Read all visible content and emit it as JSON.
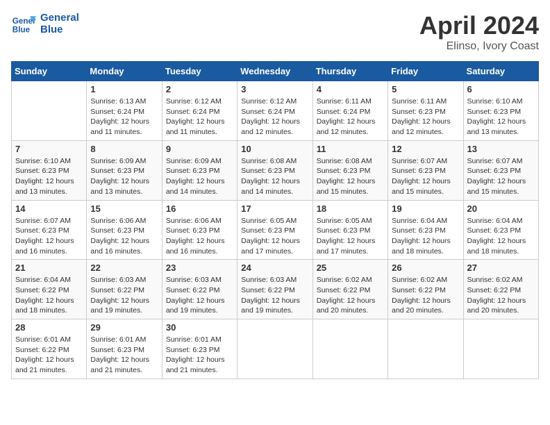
{
  "header": {
    "logo_line1": "General",
    "logo_line2": "Blue",
    "title": "April 2024",
    "subtitle": "Elinso, Ivory Coast"
  },
  "calendar": {
    "days_of_week": [
      "Sunday",
      "Monday",
      "Tuesday",
      "Wednesday",
      "Thursday",
      "Friday",
      "Saturday"
    ],
    "weeks": [
      [
        {
          "day": "",
          "info": ""
        },
        {
          "day": "1",
          "info": "Sunrise: 6:13 AM\nSunset: 6:24 PM\nDaylight: 12 hours and 11 minutes."
        },
        {
          "day": "2",
          "info": "Sunrise: 6:12 AM\nSunset: 6:24 PM\nDaylight: 12 hours and 11 minutes."
        },
        {
          "day": "3",
          "info": "Sunrise: 6:12 AM\nSunset: 6:24 PM\nDaylight: 12 hours and 12 minutes."
        },
        {
          "day": "4",
          "info": "Sunrise: 6:11 AM\nSunset: 6:24 PM\nDaylight: 12 hours and 12 minutes."
        },
        {
          "day": "5",
          "info": "Sunrise: 6:11 AM\nSunset: 6:23 PM\nDaylight: 12 hours and 12 minutes."
        },
        {
          "day": "6",
          "info": "Sunrise: 6:10 AM\nSunset: 6:23 PM\nDaylight: 12 hours and 13 minutes."
        }
      ],
      [
        {
          "day": "7",
          "info": "Sunrise: 6:10 AM\nSunset: 6:23 PM\nDaylight: 12 hours and 13 minutes."
        },
        {
          "day": "8",
          "info": "Sunrise: 6:09 AM\nSunset: 6:23 PM\nDaylight: 12 hours and 13 minutes."
        },
        {
          "day": "9",
          "info": "Sunrise: 6:09 AM\nSunset: 6:23 PM\nDaylight: 12 hours and 14 minutes."
        },
        {
          "day": "10",
          "info": "Sunrise: 6:08 AM\nSunset: 6:23 PM\nDaylight: 12 hours and 14 minutes."
        },
        {
          "day": "11",
          "info": "Sunrise: 6:08 AM\nSunset: 6:23 PM\nDaylight: 12 hours and 15 minutes."
        },
        {
          "day": "12",
          "info": "Sunrise: 6:07 AM\nSunset: 6:23 PM\nDaylight: 12 hours and 15 minutes."
        },
        {
          "day": "13",
          "info": "Sunrise: 6:07 AM\nSunset: 6:23 PM\nDaylight: 12 hours and 15 minutes."
        }
      ],
      [
        {
          "day": "14",
          "info": "Sunrise: 6:07 AM\nSunset: 6:23 PM\nDaylight: 12 hours and 16 minutes."
        },
        {
          "day": "15",
          "info": "Sunrise: 6:06 AM\nSunset: 6:23 PM\nDaylight: 12 hours and 16 minutes."
        },
        {
          "day": "16",
          "info": "Sunrise: 6:06 AM\nSunset: 6:23 PM\nDaylight: 12 hours and 16 minutes."
        },
        {
          "day": "17",
          "info": "Sunrise: 6:05 AM\nSunset: 6:23 PM\nDaylight: 12 hours and 17 minutes."
        },
        {
          "day": "18",
          "info": "Sunrise: 6:05 AM\nSunset: 6:23 PM\nDaylight: 12 hours and 17 minutes."
        },
        {
          "day": "19",
          "info": "Sunrise: 6:04 AM\nSunset: 6:23 PM\nDaylight: 12 hours and 18 minutes."
        },
        {
          "day": "20",
          "info": "Sunrise: 6:04 AM\nSunset: 6:23 PM\nDaylight: 12 hours and 18 minutes."
        }
      ],
      [
        {
          "day": "21",
          "info": "Sunrise: 6:04 AM\nSunset: 6:22 PM\nDaylight: 12 hours and 18 minutes."
        },
        {
          "day": "22",
          "info": "Sunrise: 6:03 AM\nSunset: 6:22 PM\nDaylight: 12 hours and 19 minutes."
        },
        {
          "day": "23",
          "info": "Sunrise: 6:03 AM\nSunset: 6:22 PM\nDaylight: 12 hours and 19 minutes."
        },
        {
          "day": "24",
          "info": "Sunrise: 6:03 AM\nSunset: 6:22 PM\nDaylight: 12 hours and 19 minutes."
        },
        {
          "day": "25",
          "info": "Sunrise: 6:02 AM\nSunset: 6:22 PM\nDaylight: 12 hours and 20 minutes."
        },
        {
          "day": "26",
          "info": "Sunrise: 6:02 AM\nSunset: 6:22 PM\nDaylight: 12 hours and 20 minutes."
        },
        {
          "day": "27",
          "info": "Sunrise: 6:02 AM\nSunset: 6:22 PM\nDaylight: 12 hours and 20 minutes."
        }
      ],
      [
        {
          "day": "28",
          "info": "Sunrise: 6:01 AM\nSunset: 6:22 PM\nDaylight: 12 hours and 21 minutes."
        },
        {
          "day": "29",
          "info": "Sunrise: 6:01 AM\nSunset: 6:23 PM\nDaylight: 12 hours and 21 minutes."
        },
        {
          "day": "30",
          "info": "Sunrise: 6:01 AM\nSunset: 6:23 PM\nDaylight: 12 hours and 21 minutes."
        },
        {
          "day": "",
          "info": ""
        },
        {
          "day": "",
          "info": ""
        },
        {
          "day": "",
          "info": ""
        },
        {
          "day": "",
          "info": ""
        }
      ]
    ]
  }
}
